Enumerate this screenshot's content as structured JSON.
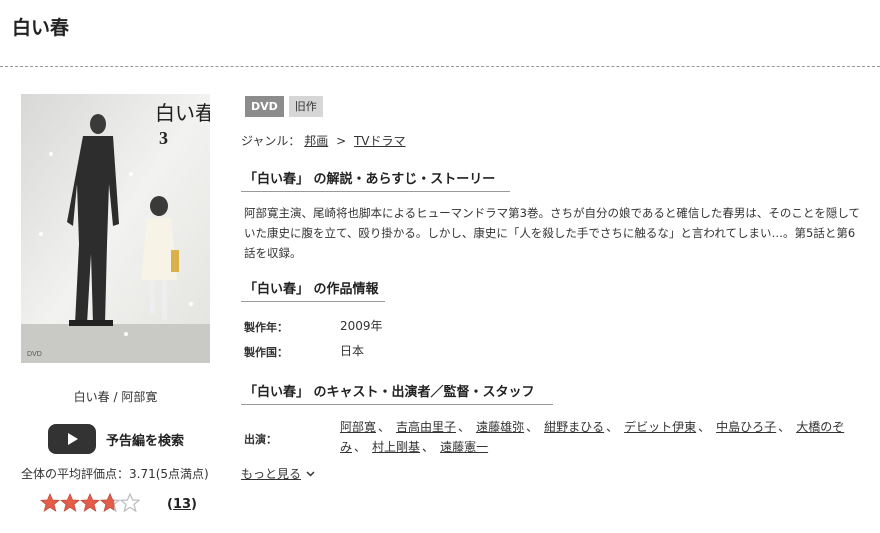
{
  "page": {
    "title": "白い春"
  },
  "cover": {
    "title_art": "白い春",
    "volume": "3",
    "caption": "白い春 / 阿部寛"
  },
  "trailer": {
    "label": "予告編を検索"
  },
  "rating": {
    "label": "全体の平均評価点：",
    "score": "3.71",
    "scale": "(5点満点)",
    "stars_value": 3.71,
    "stars_max": 5,
    "review_count": "13"
  },
  "badges": [
    "DVD",
    "旧作"
  ],
  "genre": {
    "label": "ジャンル：",
    "items": [
      "邦画",
      "TVドラマ"
    ],
    "separator": ">"
  },
  "synopsis": {
    "heading": "「白い春」 の解説・あらすじ・ストーリー",
    "text": "阿部寛主演、尾崎将也脚本によるヒューマンドラマ第3巻。さちが自分の娘であると確信した春男は、そのことを隠していた康史に腹を立て、殴り掛かる。しかし、康史に「人を殺した手でさちに触るな」と言われてしまい…。第5話と第6話を収録。"
  },
  "info": {
    "heading": "「白い春」 の作品情報",
    "rows": [
      {
        "label": "製作年：",
        "value": "2009年"
      },
      {
        "label": "製作国：",
        "value": "日本"
      }
    ]
  },
  "cast": {
    "heading": "「白い春」 のキャスト・出演者／監督・スタッフ",
    "label": "出演：",
    "names": [
      "阿部寛",
      "吉高由里子",
      "遠藤雄弥",
      "紺野まひる",
      "デビット伊東",
      "中島ひろ子",
      "大橋のぞみ",
      "村上剛基",
      "遠藤憲一"
    ],
    "more": "もっと見る"
  },
  "colors": {
    "star": "#e25d4a",
    "star_empty": "#bbbbbb",
    "badge_dvd": "#8c8c8c",
    "badge_old": "#d6d6d6"
  }
}
